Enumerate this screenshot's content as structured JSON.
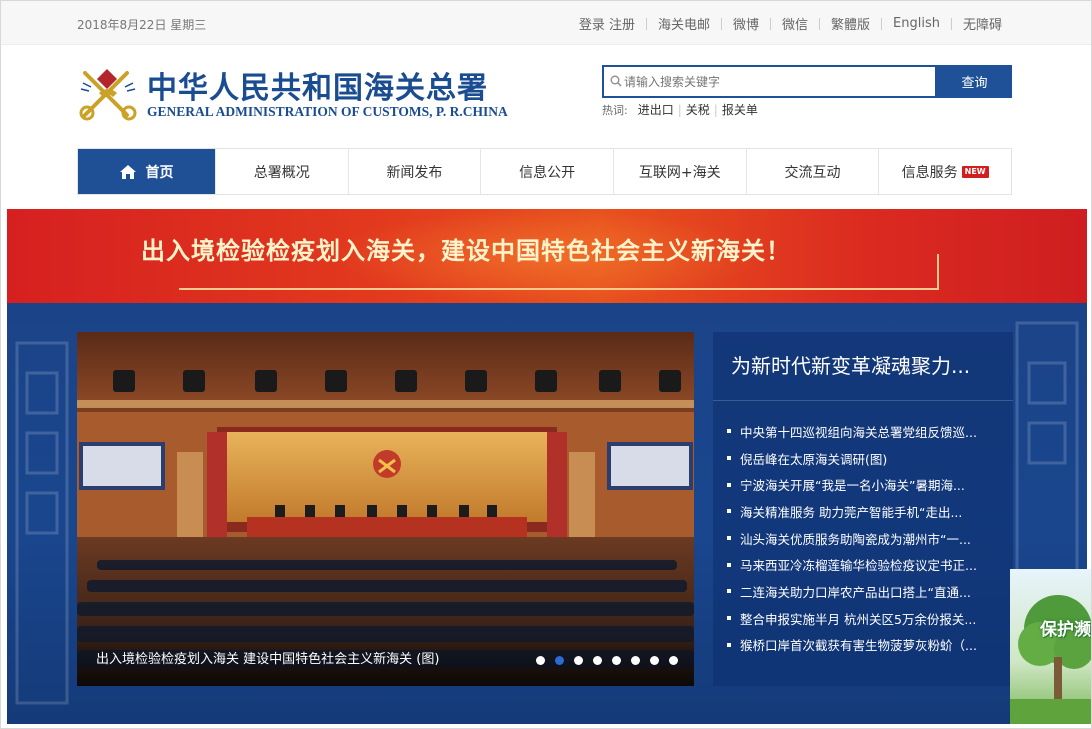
{
  "topbar": {
    "date": "2018年8月22日 星期三",
    "links": [
      "登录 注册",
      "海关电邮",
      "微博",
      "微信",
      "繁體版",
      "English",
      "无障碍"
    ]
  },
  "header": {
    "title_cn": "中华人民共和国海关总署",
    "title_en": "GENERAL ADMINISTRATION OF CUSTOMS, P. R.CHINA"
  },
  "search": {
    "placeholder": "请输入搜索关键字",
    "button_label": "查询",
    "hot_label": "热词:",
    "hot_keywords": [
      "进出口",
      "关税",
      "报关单"
    ]
  },
  "nav": {
    "items": [
      "首页",
      "总署概况",
      "新闻发布",
      "信息公开",
      "互联网+海关",
      "交流互动",
      "信息服务"
    ],
    "new_badge": "NEW"
  },
  "banner": {
    "text": "出入境检验检疫划入海关，建设中国特色社会主义新海关！"
  },
  "carousel": {
    "caption": "出入境检验检疫划入海关 建设中国特色社会主义新海关 (图)",
    "slide_count": 8,
    "active_index": 1
  },
  "news": {
    "headline": "为新时代新变革凝魂聚力...",
    "items": [
      "中央第十四巡视组向海关总署党组反馈巡...",
      "倪岳峰在太原海关调研(图)",
      "宁波海关开展“我是一名小海关”暑期海...",
      "海关精准服务 助力莞产智能手机“走出...",
      "汕头海关优质服务助陶瓷成为潮州市“一...",
      "马来西亚冷冻榴莲输华检验检疫议定书正...",
      "二连海关助力口岸农产品出口搭上“直通...",
      "整合申报实施半月 杭州关区5万余份报关...",
      "猴桥口岸首次截获有害生物菠萝灰粉蚧（..."
    ]
  },
  "side_ad": {
    "text": "保护濒"
  },
  "colors": {
    "brand_blue": "#1f5096",
    "banner_red": "#d62020",
    "banner_text": "#fff3c9"
  }
}
